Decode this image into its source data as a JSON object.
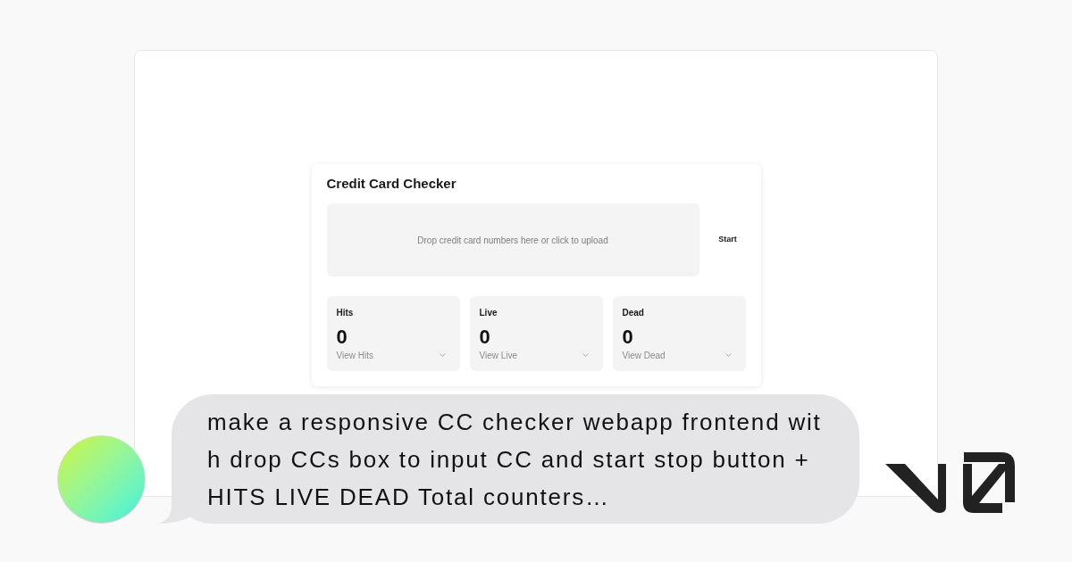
{
  "preview": {
    "card": {
      "title": "Credit Card Checker",
      "dropzone": {
        "prompt": "Drop credit card numbers here or click to upload"
      },
      "start_button": {
        "label": "Start"
      },
      "counters": [
        {
          "label": "Hits",
          "value": "0",
          "toggle": "View Hits",
          "expanded": false
        },
        {
          "label": "Live",
          "value": "0",
          "toggle": "View Live",
          "expanded": false
        },
        {
          "label": "Dead",
          "value": "0",
          "toggle": "View Dead",
          "expanded": false
        }
      ]
    }
  },
  "message": {
    "text": "make a responsive CC checker webapp frontend wit\nh drop CCs box to input CC and start stop button +\nHITS LIVE DEAD Total counters…"
  }
}
